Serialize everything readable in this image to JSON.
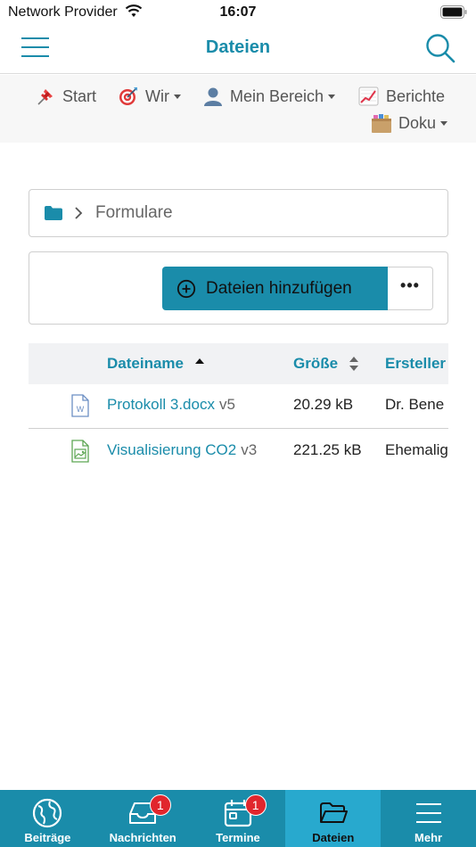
{
  "status_bar": {
    "carrier": "Network Provider",
    "time": "16:07"
  },
  "header": {
    "title": "Dateien"
  },
  "sub_nav": {
    "items": [
      {
        "label": "Start",
        "icon": "pushpin-icon",
        "has_dropdown": false
      },
      {
        "label": "Wir",
        "icon": "target-icon",
        "has_dropdown": true
      },
      {
        "label": "Mein Bereich",
        "icon": "user-icon",
        "has_dropdown": true
      },
      {
        "label": "Berichte",
        "icon": "chart-icon",
        "has_dropdown": false
      },
      {
        "label": "Doku",
        "icon": "box-icon",
        "has_dropdown": true
      }
    ]
  },
  "breadcrumb": {
    "folder": "Formulare"
  },
  "actions": {
    "add_label": "Dateien hinzufügen",
    "more_label": "•••"
  },
  "table": {
    "columns": [
      "Dateiname",
      "Größe",
      "Ersteller"
    ],
    "sort_column": "Dateiname",
    "rows": [
      {
        "name": "Protokoll 3.docx",
        "version": "v5",
        "size": "20.29 kB",
        "creator": "Dr. Bene",
        "type": "word-document-icon"
      },
      {
        "name": "Visualisierung CO2",
        "version": "v3",
        "size": "221.25 kB",
        "creator": "Ehemalig",
        "type": "image-file-icon"
      }
    ]
  },
  "tab_bar": {
    "tabs": [
      {
        "label": "Beiträge",
        "icon": "globe-icon",
        "badge": ""
      },
      {
        "label": "Nachrichten",
        "icon": "inbox-icon",
        "badge": "1"
      },
      {
        "label": "Termine",
        "icon": "calendar-icon",
        "badge": "1"
      },
      {
        "label": "Dateien",
        "icon": "folder-open-icon",
        "badge": "",
        "active": true
      },
      {
        "label": "Mehr",
        "icon": "menu-icon",
        "badge": ""
      }
    ]
  },
  "colors": {
    "accent": "#1a8caa",
    "active_tab": "#28a9ce",
    "badge": "#e1262d"
  }
}
